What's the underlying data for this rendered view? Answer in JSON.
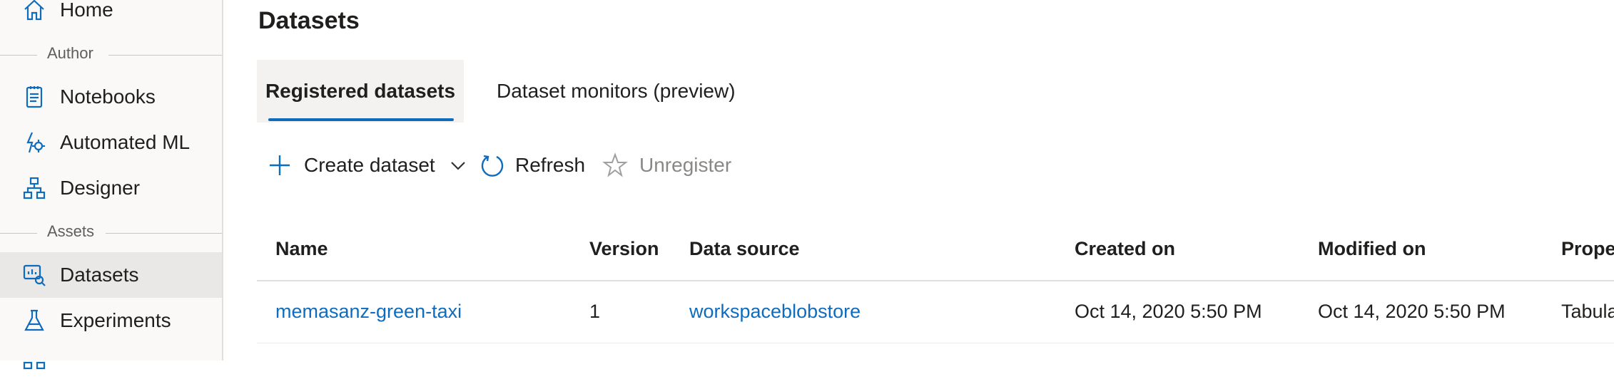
{
  "sidebar": {
    "items": [
      {
        "key": "home",
        "label": "Home",
        "icon": "home-icon"
      },
      {
        "key": "notebooks",
        "label": "Notebooks",
        "icon": "notebook-icon"
      },
      {
        "key": "automated_ml",
        "label": "Automated ML",
        "icon": "automated-ml-icon"
      },
      {
        "key": "designer",
        "label": "Designer",
        "icon": "designer-icon"
      },
      {
        "key": "datasets",
        "label": "Datasets",
        "icon": "datasets-icon",
        "selected": true
      },
      {
        "key": "experiments",
        "label": "Experiments",
        "icon": "flask-icon"
      }
    ],
    "sections": {
      "author": "Author",
      "assets": "Assets"
    }
  },
  "page": {
    "title": "Datasets"
  },
  "tabs": [
    {
      "label": "Registered datasets",
      "active": true
    },
    {
      "label": "Dataset monitors (preview)",
      "active": false
    }
  ],
  "toolbar": {
    "create_label": "Create dataset",
    "refresh_label": "Refresh",
    "unregister_label": "Unregister"
  },
  "table": {
    "columns": [
      "Name",
      "Version",
      "Data source",
      "Created on",
      "Modified on",
      "Proper"
    ],
    "rows": [
      {
        "name": "memasanz-green-taxi",
        "version": "1",
        "data_source": "workspaceblobstore",
        "created_on": "Oct 14, 2020 5:50 PM",
        "modified_on": "Oct 14, 2020 5:50 PM",
        "properties": "Tabula"
      }
    ]
  },
  "colors": {
    "accent": "#0f6cbd",
    "sidebar_bg": "#faf9f8",
    "selected_bg": "#e9e8e7",
    "disabled_text": "#8a8886"
  }
}
